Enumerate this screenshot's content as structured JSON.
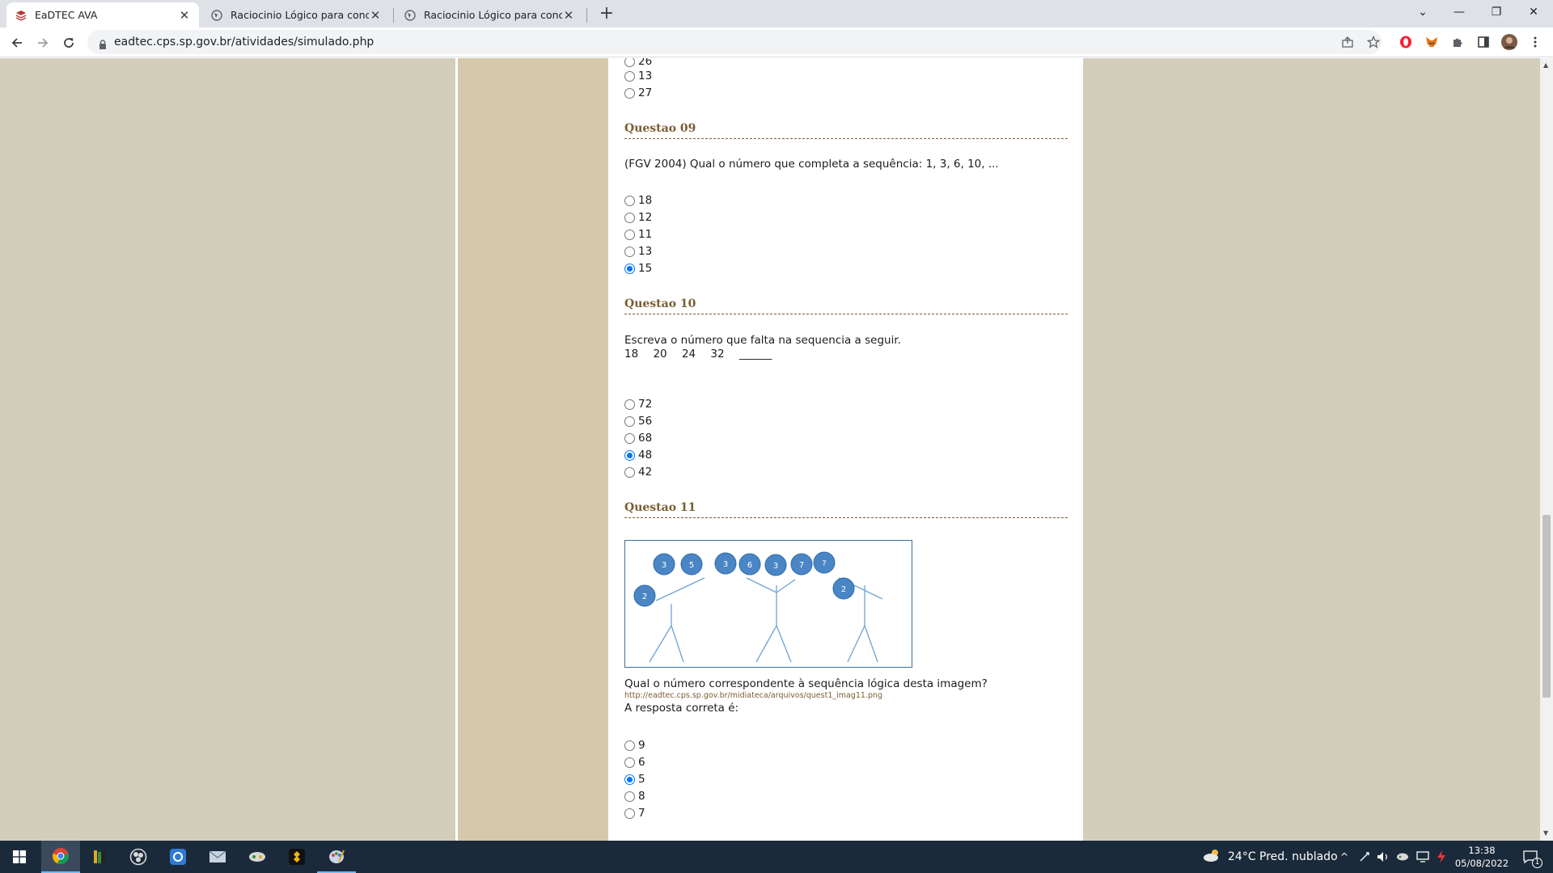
{
  "browser": {
    "tabs": [
      {
        "title": "EaDTEC AVA",
        "active": true
      },
      {
        "title": "Raciocinio Lógico para concursos",
        "active": false
      },
      {
        "title": "Raciocinio Lógico para concursos",
        "active": false
      }
    ],
    "url": "eadtec.cps.sp.gov.br/atividades/simulado.php"
  },
  "page": {
    "prev_question": {
      "options": [
        "26",
        "13",
        "27"
      ]
    },
    "questions": [
      {
        "header": "Questao 09",
        "text": "(FGV 2004) Qual o número que completa a sequência: 1, 3, 6, 10, ...",
        "options": [
          "18",
          "12",
          "11",
          "13",
          "15"
        ],
        "selected": "15"
      },
      {
        "header": "Questao 10",
        "text": "Escreva o número que falta na sequencia a seguir.",
        "sequence": "18 20 24 32 ______",
        "options": [
          "72",
          "56",
          "68",
          "48",
          "42"
        ],
        "selected": "48"
      },
      {
        "header": "Questao 11",
        "text": "Qual o número correspondente à sequência lógica desta imagem?",
        "link": "http://eadtec.cps.sp.gov.br/midiateca/arquivos/quest1_imag11.png",
        "subtext": "A resposta correta é:",
        "options": [
          "9",
          "6",
          "5",
          "8",
          "7"
        ],
        "selected": "5",
        "figure": {
          "labels": [
            "2",
            "3",
            "5",
            "3",
            "6",
            "3",
            "7",
            "?",
            "2"
          ],
          "circle_color": "#4a86c5"
        }
      }
    ]
  },
  "taskbar": {
    "weather": "24°C  Pred. nublado",
    "time": "13:38",
    "date": "05/08/2022",
    "notification_count": "1"
  }
}
